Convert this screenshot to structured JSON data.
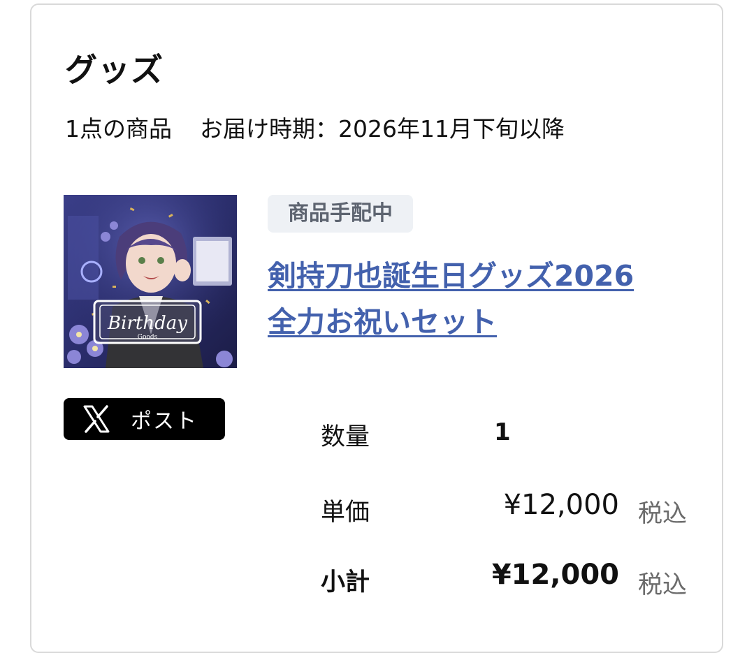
{
  "section": {
    "title": "グッズ",
    "item_count": "1点の商品",
    "delivery": "お届け時期：2026年11月下旬以降"
  },
  "product": {
    "status_badge": "商品手配中",
    "title_line1": "剣持刀也誕生日グッズ2026",
    "title_line2": "全力お祝いセット",
    "thumbnail": {
      "banner_text": "Birthday",
      "banner_subtext": "Goods"
    }
  },
  "share": {
    "label": "ポスト",
    "icon": "x-logo-icon"
  },
  "order": {
    "quantity_label": "数量",
    "quantity_value": "1",
    "unit_price_label": "単価",
    "unit_price_value": "¥12,000",
    "unit_price_tax": "税込",
    "subtotal_label": "小計",
    "subtotal_value": "¥12,000",
    "subtotal_tax": "税込"
  },
  "colors": {
    "link": "#4361ad",
    "badge_bg": "#eef1f5",
    "badge_text": "#5d6470",
    "card_border": "#d9d9d9",
    "x_button": "#000000"
  }
}
